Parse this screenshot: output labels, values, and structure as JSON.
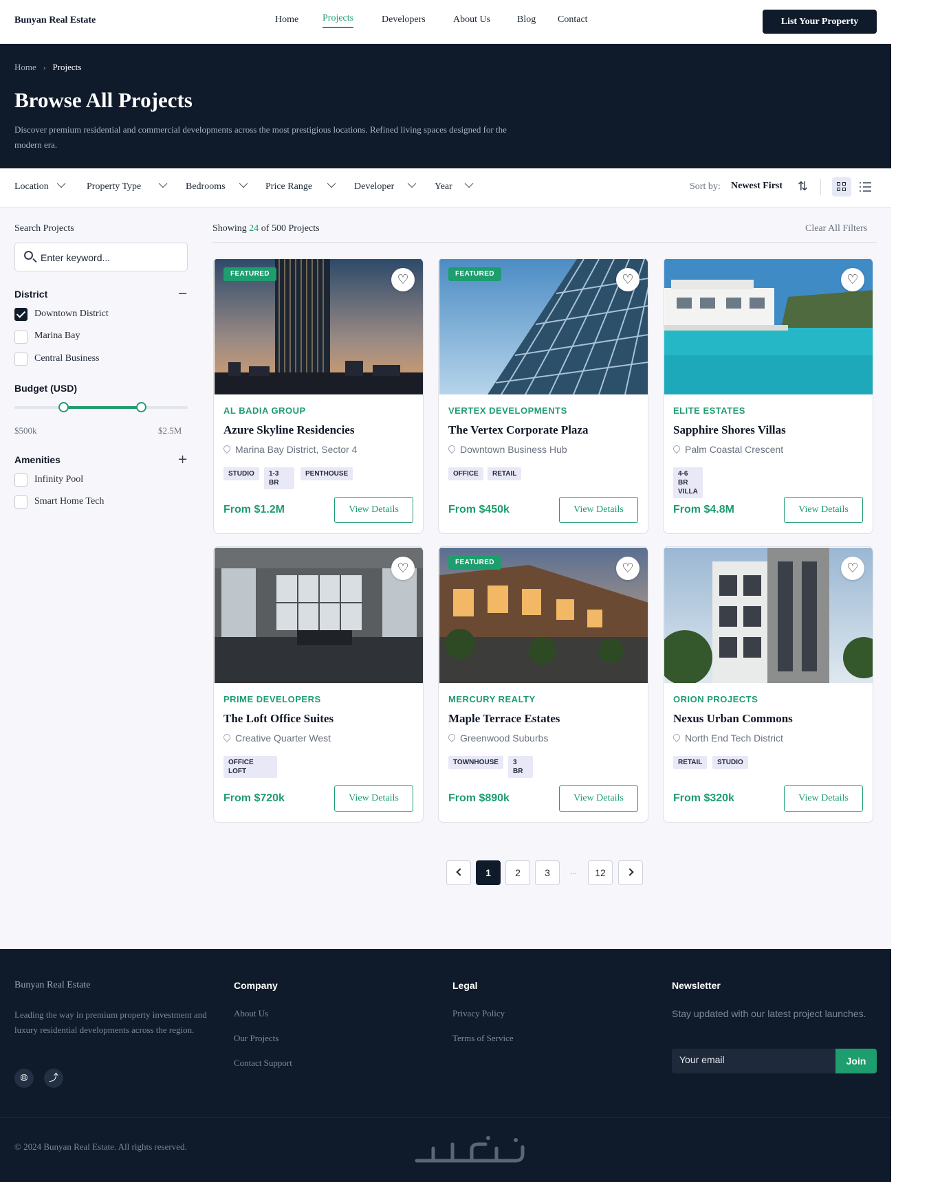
{
  "brand": "Bunyan Real Estate",
  "nav": {
    "items": [
      {
        "label": "Home",
        "active": false
      },
      {
        "label": "Projects",
        "active": true
      },
      {
        "label": "Developers",
        "active": false
      },
      {
        "label": "About Us",
        "active": false
      },
      {
        "label": "Blog",
        "active": false
      },
      {
        "label": "Contact",
        "active": false
      }
    ],
    "cta": "List Your Property"
  },
  "hero": {
    "breadcrumb": {
      "home": "Home",
      "separator": "›",
      "current": "Projects"
    },
    "title": "Browse All Projects",
    "description": "Discover premium residential and commercial developments across the most prestigious locations. Refined living spaces designed for the modern era."
  },
  "filters": {
    "items": [
      "Location",
      "Property Type",
      "Bedrooms",
      "Price Range",
      "Developer",
      "Year"
    ],
    "sort_label": "Sort by:",
    "sort_value": "Newest First",
    "sort_icon": "sort-arrows-icon",
    "views": {
      "grid": "grid-view-icon",
      "list": "list-view-icon",
      "active": "grid"
    }
  },
  "sidebar": {
    "search_label": "Search Projects",
    "search_placeholder": "Enter keyword...",
    "district": {
      "title": "District",
      "toggle": "−",
      "options": [
        {
          "label": "Downtown District",
          "checked": true
        },
        {
          "label": "Marina Bay",
          "checked": false
        },
        {
          "label": "Central Business",
          "checked": false
        }
      ]
    },
    "budget": {
      "title": "Budget (USD)",
      "min_label": "$500k",
      "max_label": "$2.5M",
      "low_fraction": 0.28,
      "high_fraction": 0.73
    },
    "amenities": {
      "title": "Amenities",
      "toggle": "+",
      "options": [
        {
          "label": "Infinity Pool",
          "checked": false
        },
        {
          "label": "Smart Home Tech",
          "checked": false
        }
      ]
    }
  },
  "results": {
    "showing_prefix": "Showing",
    "showing_count": "24",
    "showing_suffix": "of 500 Projects",
    "clear_all": "Clear All Filters"
  },
  "projects": [
    {
      "featured": true,
      "badge": "FEATURED",
      "developer": "AL BADIA GROUP",
      "name": "Azure Skyline Residencies",
      "location": "Marina Bay District, Sector 4",
      "tags": [
        "STUDIO",
        "1-3 BR",
        "PENTHOUSE"
      ],
      "price": "From $1.2M",
      "button": "View Details",
      "image": "tower-at-dusk"
    },
    {
      "featured": true,
      "badge": "FEATURED",
      "developer": "VERTEX DEVELOPMENTS",
      "name": "The Vertex Corporate Plaza",
      "location": "Downtown Business Hub",
      "tags": [
        "OFFICE",
        "RETAIL"
      ],
      "price": "From $450k",
      "button": "View Details",
      "image": "glass-office-tower"
    },
    {
      "featured": false,
      "badge": "",
      "developer": "ELITE ESTATES",
      "name": "Sapphire Shores Villas",
      "location": "Palm Coastal Crescent",
      "tags": [
        "4-6 BR VILLA"
      ],
      "price": "From $4.8M",
      "button": "View Details",
      "image": "villa-pool"
    },
    {
      "featured": false,
      "badge": "",
      "developer": "PRIME DEVELOPERS",
      "name": "The Loft Office Suites",
      "location": "Creative Quarter West",
      "tags": [
        "OFFICE LOFT"
      ],
      "price": "From $720k",
      "button": "View Details",
      "image": "loft-interior"
    },
    {
      "featured": true,
      "badge": "FEATURED",
      "developer": "MERCURY REALTY",
      "name": "Maple Terrace Estates",
      "location": "Greenwood Suburbs",
      "tags": [
        "TOWNHOUSE",
        "3 BR"
      ],
      "price": "From $890k",
      "button": "View Details",
      "image": "townhouses"
    },
    {
      "featured": false,
      "badge": "",
      "developer": "ORION PROJECTS",
      "name": "Nexus Urban Commons",
      "location": "North End Tech District",
      "tags": [
        "RETAIL",
        "STUDIO"
      ],
      "price": "From $320k",
      "button": "View Details",
      "image": "apartment-block"
    }
  ],
  "pagination": {
    "prev": "prev-icon",
    "pages": [
      "1",
      "2",
      "3"
    ],
    "ellipsis": "...",
    "last": "12",
    "next": "next-icon",
    "current": "1"
  },
  "footer": {
    "brand": "Bunyan Real Estate",
    "description": "Leading the way in premium property investment and luxury residential developments across the region.",
    "social": [
      "globe-icon",
      "share-icon"
    ],
    "company": {
      "title": "Company",
      "links": [
        "About Us",
        "Our Projects",
        "Contact Support"
      ]
    },
    "legal": {
      "title": "Legal",
      "links": [
        "Privacy Policy",
        "Terms of Service"
      ]
    },
    "newsletter": {
      "title": "Newsletter",
      "text": "Stay updated with our latest project launches.",
      "placeholder": "Your email",
      "button": "Join"
    },
    "copyright": "© 2024 Bunyan Real Estate. All rights reserved.",
    "watermark": "watermark-logo"
  },
  "colors": {
    "accent": "#1e9d6e",
    "navy": "#0f1a2a",
    "tag_bg": "#e9e8f7"
  }
}
